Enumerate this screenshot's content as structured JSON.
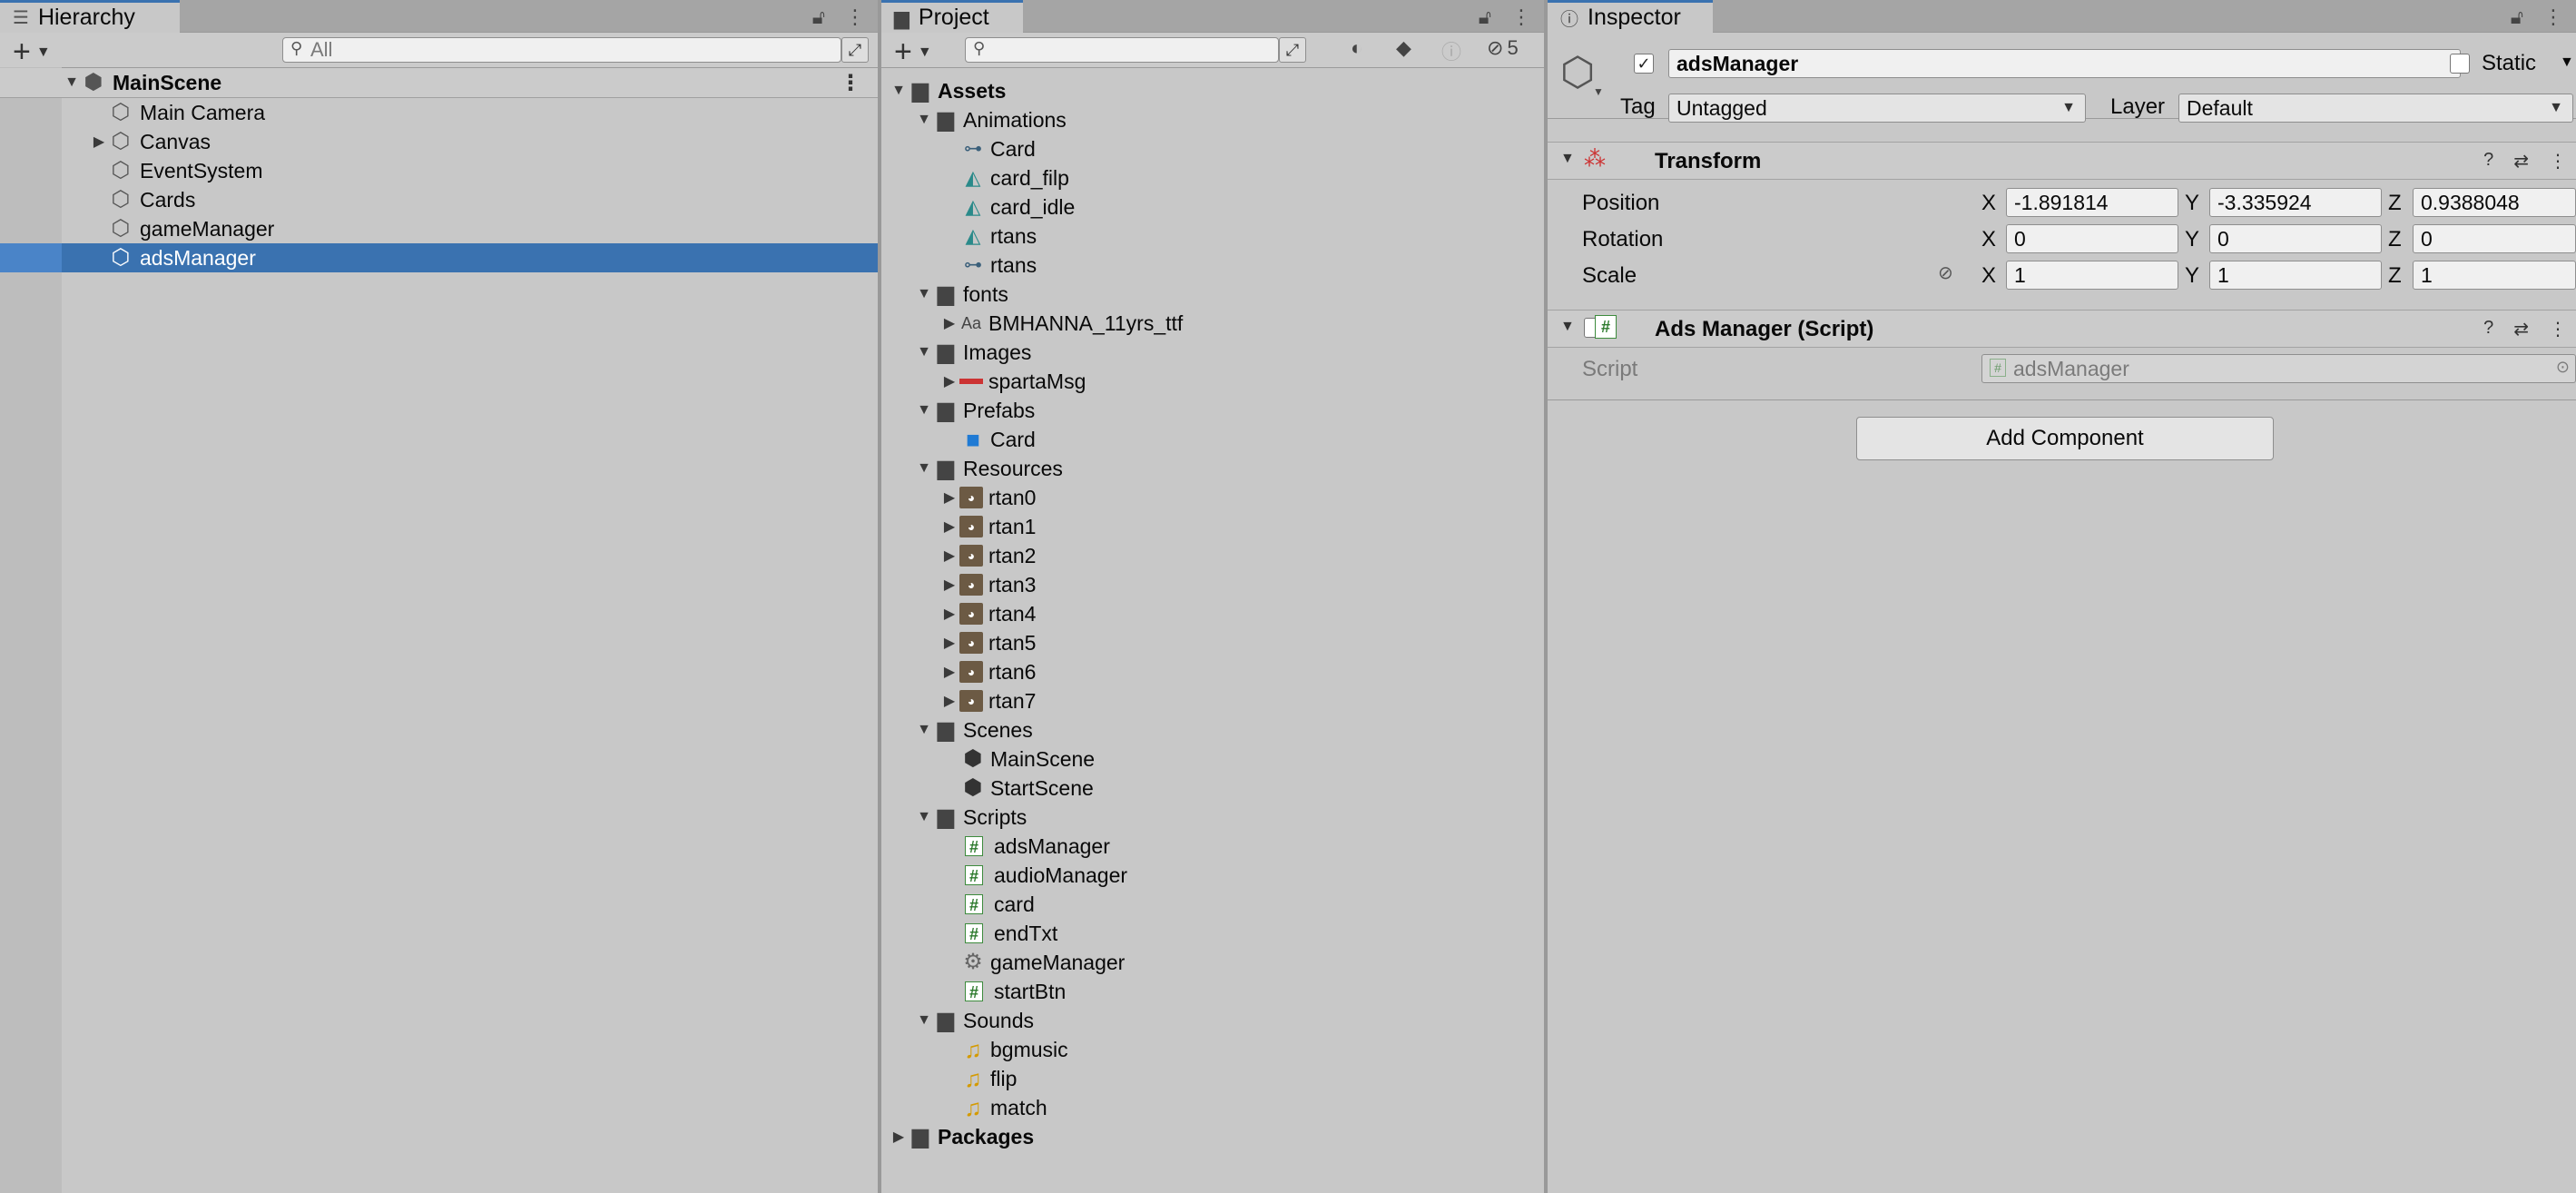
{
  "hierarchy": {
    "tab_label": "Hierarchy",
    "search_placeholder": "All",
    "scene": "MainScene",
    "items": [
      {
        "label": "Main Camera"
      },
      {
        "label": "Canvas"
      },
      {
        "label": "EventSystem"
      },
      {
        "label": "Cards"
      },
      {
        "label": "gameManager"
      },
      {
        "label": "adsManager"
      }
    ]
  },
  "project": {
    "tab_label": "Project",
    "hidden_count": "5",
    "tree": [
      {
        "label": "Assets"
      },
      {
        "label": "Animations"
      },
      {
        "label": "Card"
      },
      {
        "label": "card_filp"
      },
      {
        "label": "card_idle"
      },
      {
        "label": "rtans"
      },
      {
        "label": "rtans"
      },
      {
        "label": "fonts"
      },
      {
        "label": "BMHANNA_11yrs_ttf"
      },
      {
        "label": "Images"
      },
      {
        "label": "spartaMsg"
      },
      {
        "label": "Prefabs"
      },
      {
        "label": "Card"
      },
      {
        "label": "Resources"
      },
      {
        "label": "rtan0"
      },
      {
        "label": "rtan1"
      },
      {
        "label": "rtan2"
      },
      {
        "label": "rtan3"
      },
      {
        "label": "rtan4"
      },
      {
        "label": "rtan5"
      },
      {
        "label": "rtan6"
      },
      {
        "label": "rtan7"
      },
      {
        "label": "Scenes"
      },
      {
        "label": "MainScene"
      },
      {
        "label": "StartScene"
      },
      {
        "label": "Scripts"
      },
      {
        "label": "adsManager"
      },
      {
        "label": "audioManager"
      },
      {
        "label": "card"
      },
      {
        "label": "endTxt"
      },
      {
        "label": "gameManager"
      },
      {
        "label": "startBtn"
      },
      {
        "label": "Sounds"
      },
      {
        "label": "bgmusic"
      },
      {
        "label": "flip"
      },
      {
        "label": "match"
      },
      {
        "label": "Packages"
      }
    ]
  },
  "inspector": {
    "tab_label": "Inspector",
    "object_name": "adsManager",
    "static_label": "Static",
    "tag_label": "Tag",
    "tag_value": "Untagged",
    "layer_label": "Layer",
    "layer_value": "Default",
    "transform": {
      "title": "Transform",
      "position_label": "Position",
      "rotation_label": "Rotation",
      "scale_label": "Scale",
      "axes": {
        "x": "X",
        "y": "Y",
        "z": "Z"
      },
      "position": {
        "x": "-1.891814",
        "y": "-3.335924",
        "z": "0.9388048"
      },
      "rotation": {
        "x": "0",
        "y": "0",
        "z": "0"
      },
      "scale": {
        "x": "1",
        "y": "1",
        "z": "1"
      }
    },
    "script_component": {
      "title": "Ads Manager (Script)",
      "script_label": "Script",
      "script_value": "adsManager"
    },
    "add_component_label": "Add Component"
  },
  "colors": {
    "selection": "#3a72b0",
    "panel_bg": "#c8c8c8",
    "tab_accent": "#3a72b0"
  }
}
